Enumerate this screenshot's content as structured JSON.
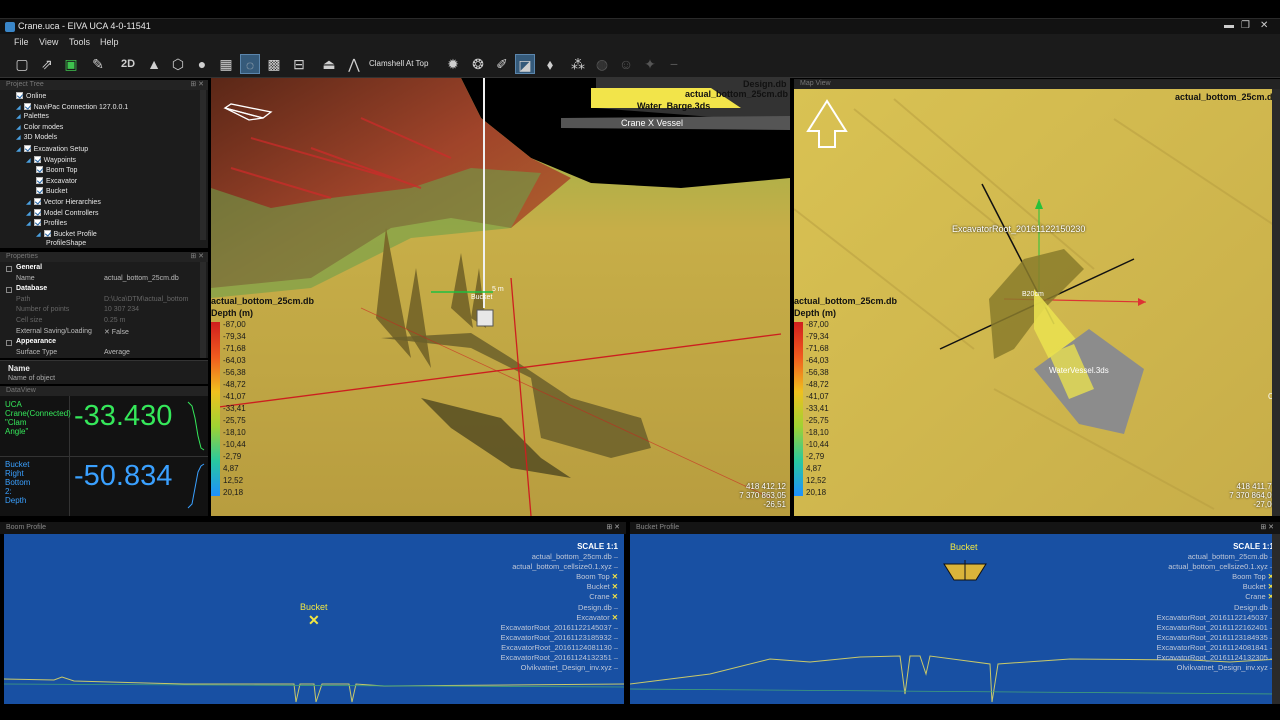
{
  "window": {
    "title": "Crane.uca - EIVA UCA 4-0-11541",
    "minimize": "▬",
    "restore": "❐",
    "close": "✕"
  },
  "menu": [
    "File",
    "View",
    "Tools",
    "Help"
  ],
  "toolbar": {
    "view_2d": "2D",
    "clamshell_label": "Clamshell At Top"
  },
  "project_tree": {
    "header": "Project Tree",
    "items": [
      {
        "label": "Online",
        "indent": 1,
        "arrow": false,
        "check": true
      },
      {
        "label": "NaviPac Connection 127.0.0.1",
        "indent": 1,
        "arrow": true,
        "check": true
      },
      {
        "label": "Palettes",
        "indent": 1,
        "arrow": true,
        "check": false
      },
      {
        "label": "Color modes",
        "indent": 1,
        "arrow": true,
        "check": false
      },
      {
        "label": "3D Models",
        "indent": 1,
        "arrow": true,
        "check": false
      },
      {
        "label": "Excavation Setup",
        "indent": 1,
        "arrow": true,
        "check": true
      },
      {
        "label": "Waypoints",
        "indent": 2,
        "arrow": true,
        "check": true
      },
      {
        "label": "Boom Top",
        "indent": 3,
        "arrow": false,
        "check": true
      },
      {
        "label": "Excavator",
        "indent": 3,
        "arrow": false,
        "check": true
      },
      {
        "label": "Bucket",
        "indent": 3,
        "arrow": false,
        "check": true
      },
      {
        "label": "Vector Hierarchies",
        "indent": 2,
        "arrow": true,
        "check": true
      },
      {
        "label": "Model Controllers",
        "indent": 2,
        "arrow": true,
        "check": true
      },
      {
        "label": "Profiles",
        "indent": 2,
        "arrow": true,
        "check": true
      },
      {
        "label": "Bucket Profile",
        "indent": 3,
        "arrow": true,
        "check": true
      },
      {
        "label": "ProfileShape",
        "indent": 4,
        "arrow": false,
        "check": false
      }
    ]
  },
  "properties": {
    "header": "Properties",
    "rows": [
      {
        "type": "sec",
        "k": "General",
        "v": ""
      },
      {
        "type": "row",
        "k": "Name",
        "v": "actual_bottom_25cm.db"
      },
      {
        "type": "sec",
        "k": "Database",
        "v": ""
      },
      {
        "type": "dim",
        "k": "Path",
        "v": "D:\\Uca\\DTM\\actual_bottom"
      },
      {
        "type": "dim",
        "k": "Number of points",
        "v": "10 307 234"
      },
      {
        "type": "dim",
        "k": "Cell size",
        "v": "0.25 m"
      },
      {
        "type": "row",
        "k": "External Saving/Loading",
        "v": "✕  False"
      },
      {
        "type": "sec",
        "k": "Appearance",
        "v": ""
      },
      {
        "type": "row",
        "k": "Surface Type",
        "v": "Average"
      }
    ],
    "name_title": "Name",
    "name_desc": "Name of object"
  },
  "dataview": {
    "header": "DataView",
    "rows": [
      {
        "label": "UCA\nCrane(Connected)\n\"Clam\nAngle\"",
        "value": "-33.430",
        "color": "#35e85a"
      },
      {
        "label": "Bucket\nRight\nBottom\n2:\nDepth",
        "value": "-50.834",
        "color": "#3aa0ff"
      }
    ]
  },
  "view3d": {
    "labels": {
      "design": "Design.db",
      "actual_top": "actual_bottom_25cm.db",
      "barge": "Water_Barge.3ds",
      "crane": "Crane X Vessel",
      "actual_left": "actual_bottom_25cm.db",
      "depth": "Depth (m)",
      "marker": "5 m",
      "bucket": "Bucket"
    },
    "scale": [
      "-87,00",
      "-79,34",
      "-71,68",
      "-64,03",
      "-56,38",
      "-48,72",
      "-41,07",
      "-33,41",
      "-25,75",
      "-18,10",
      "-10,44",
      "-2,79",
      "4,87",
      "12,52",
      "20,18"
    ],
    "coords": [
      "418 412,12",
      "7 370 863,05",
      "-26,51"
    ]
  },
  "mapview": {
    "header": "Map View",
    "labels": {
      "actual_top": "actual_bottom_25cm.db",
      "actual_left": "actual_bottom_25cm.db",
      "depth": "Depth (m)",
      "root": "ExcavatorRoot_20161122150230",
      "b20": "B20cm",
      "vessel": "WaterVessel.3ds",
      "edge": "Olv"
    },
    "scale": [
      "-87,00",
      "-79,34",
      "-71,68",
      "-64,03",
      "-56,38",
      "-48,72",
      "-41,07",
      "-33,41",
      "-25,75",
      "-18,10",
      "-10,44",
      "-2,79",
      "4,87",
      "12,52",
      "20,18"
    ],
    "coords": [
      "418 411,77",
      "7 370 864,09",
      "-27,00"
    ]
  },
  "boom_profile": {
    "header": "Boom Profile",
    "scale": "SCALE 1:1",
    "bucket_label": "Bucket",
    "legend": [
      {
        "t": "actual_bottom_25cm.db",
        "m": "d"
      },
      {
        "t": "actual_bottom_cellsize0.1.xyz",
        "m": "d"
      },
      {
        "t": "Boom Top",
        "m": "x"
      },
      {
        "t": "Bucket",
        "m": "x"
      },
      {
        "t": "Crane",
        "m": "x"
      },
      {
        "t": "Design.db",
        "m": "d"
      },
      {
        "t": "Excavator",
        "m": "x"
      },
      {
        "t": "ExcavatorRoot_20161122145037",
        "m": "d"
      },
      {
        "t": "ExcavatorRoot_20161123185932",
        "m": "d"
      },
      {
        "t": "ExcavatorRoot_20161124081130",
        "m": "d"
      },
      {
        "t": "ExcavatorRoot_20161124132351",
        "m": "d"
      },
      {
        "t": "Olvikvatnet_Design_inv.xyz",
        "m": "d"
      }
    ]
  },
  "bucket_profile": {
    "header": "Bucket Profile",
    "scale": "SCALE 1:1",
    "bucket_label": "Bucket",
    "legend": [
      {
        "t": "actual_bottom_25cm.db",
        "m": "d"
      },
      {
        "t": "actual_bottom_cellsize0.1.xyz",
        "m": "d"
      },
      {
        "t": "Boom Top",
        "m": "x"
      },
      {
        "t": "Bucket",
        "m": "x"
      },
      {
        "t": "Crane",
        "m": "x"
      },
      {
        "t": "Design.db",
        "m": "d"
      },
      {
        "t": "ExcavatorRoot_20161122145037",
        "m": "d"
      },
      {
        "t": "ExcavatorRoot_20161122162401",
        "m": "d"
      },
      {
        "t": "ExcavatorRoot_20161123184935",
        "m": "d"
      },
      {
        "t": "ExcavatorRoot_20161124081841",
        "m": "d"
      },
      {
        "t": "ExcavatorRoot_20161124132305",
        "m": "d"
      },
      {
        "t": "Olvikvatnet_Design_inv.xyz",
        "m": "d"
      }
    ]
  }
}
